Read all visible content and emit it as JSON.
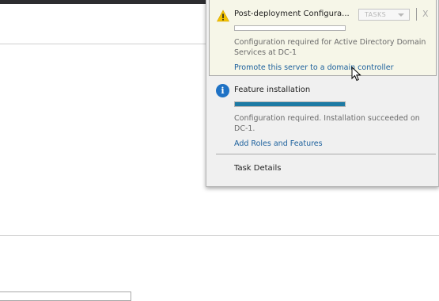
{
  "notifications": [
    {
      "title": "Post-deployment Configura...",
      "tasks_label": "TASKS",
      "close_label": "X",
      "description": "Configuration required for Active Directory Domain Services at DC-1",
      "link": "Promote this server to a domain controller",
      "icon": "warning-icon",
      "progress": 0
    },
    {
      "title": "Feature installation",
      "description": "Configuration required. Installation succeeded on DC-1.",
      "link": "Add Roles and Features",
      "icon": "info-icon",
      "icon_glyph": "i",
      "progress": 1.0
    }
  ],
  "task_details_label": "Task Details",
  "colors": {
    "link": "#1a5f9c",
    "progress_fill": "#1d7aa4",
    "info_icon": "#1f72c5",
    "warning_icon": "#f2c200"
  }
}
